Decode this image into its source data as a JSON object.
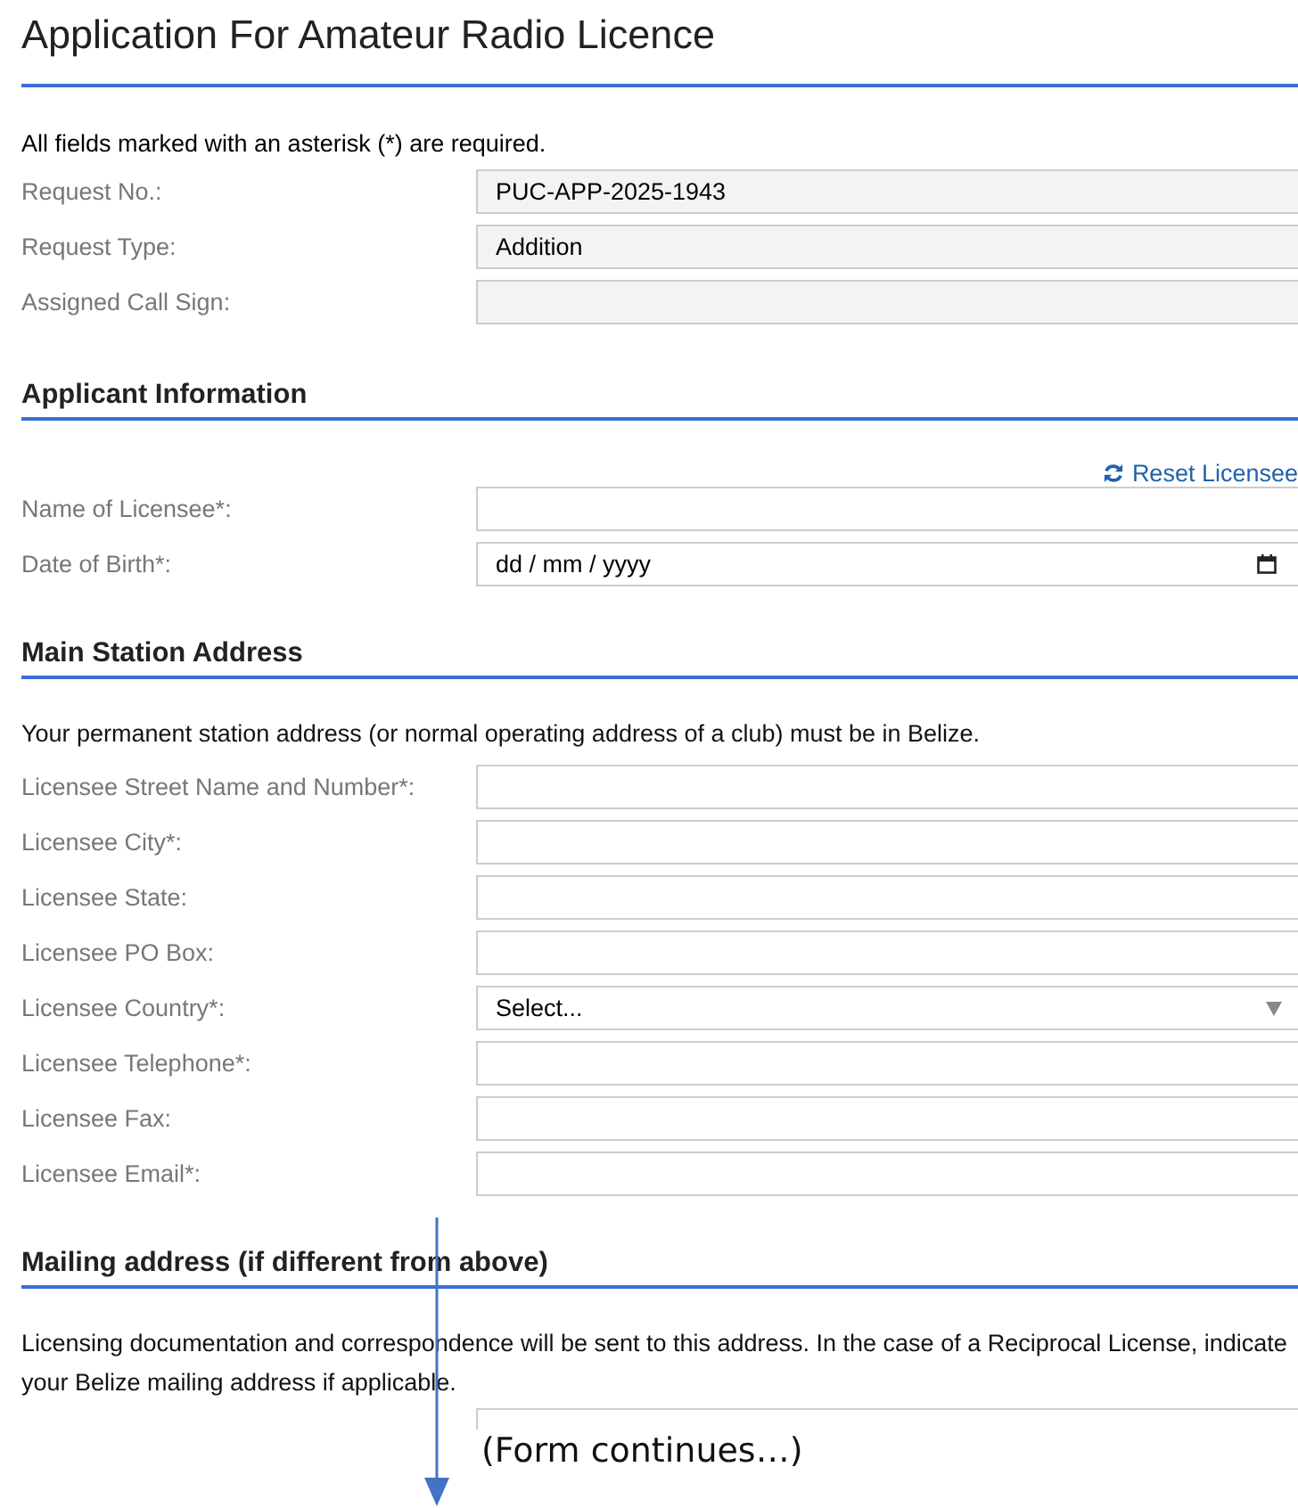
{
  "page": {
    "title": "Application For Amateur Radio Licence"
  },
  "required_note": "All fields marked with an asterisk (*) are required.",
  "header_fields": [
    {
      "label": "Request No.:",
      "kind": "readonly",
      "value": "PUC-APP-2025-1943"
    },
    {
      "label": "Request Type:",
      "kind": "readonly",
      "value": "Addition"
    },
    {
      "label": "Assigned Call Sign:",
      "kind": "readonly"
    }
  ],
  "sections": [
    {
      "title": "Applicant Information",
      "action": "Reset Licensee",
      "fields": [
        {
          "label": "Name of Licensee*:",
          "kind": "text"
        },
        {
          "label": "Date of Birth*:",
          "kind": "date",
          "placeholder": "dd / mm / yyyy"
        }
      ]
    },
    {
      "title": "Main Station Address",
      "note": "Your permanent station address (or normal operating address of a club) must be in Belize.",
      "fields": [
        {
          "label": "Licensee Street Name and Number*:",
          "kind": "text"
        },
        {
          "label": "Licensee City*:",
          "kind": "text"
        },
        {
          "label": "Licensee State:",
          "kind": "text"
        },
        {
          "label": "Licensee PO Box:",
          "kind": "text"
        },
        {
          "label": "Licensee Country*:",
          "kind": "select",
          "value": "Select..."
        },
        {
          "label": "Licensee Telephone*:",
          "kind": "text"
        },
        {
          "label": "Licensee Fax:",
          "kind": "text"
        },
        {
          "label": "Licensee Email*:",
          "kind": "text"
        }
      ]
    },
    {
      "title": "Mailing address (if different from above)",
      "note": "Licensing documentation and correspondence will be sent to this address. In the case of a Reciprocal License, indicate your Belize mailing address if applicable.",
      "fields": [
        {
          "kind": "text",
          "clipped": true
        }
      ]
    }
  ],
  "annotation": {
    "text": "(Form continues…)"
  }
}
